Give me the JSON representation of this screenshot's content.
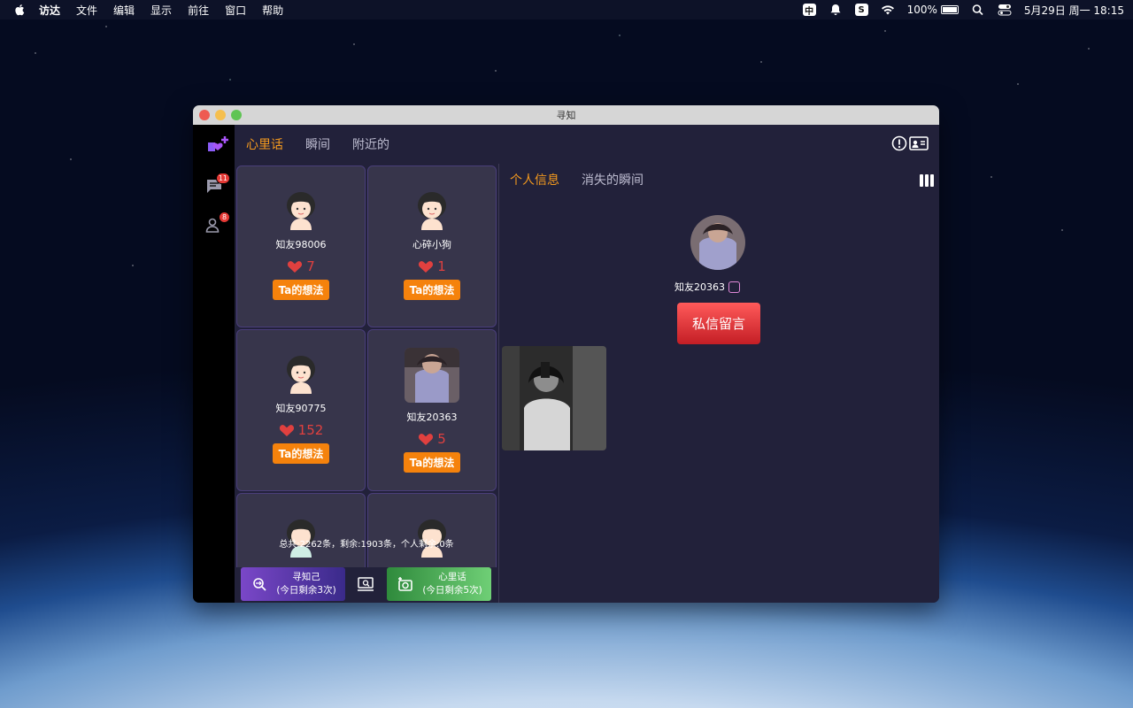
{
  "menubar": {
    "items": [
      "访达",
      "文件",
      "编辑",
      "显示",
      "前往",
      "窗口",
      "帮助"
    ],
    "input_method": "中",
    "sogou": "S",
    "battery": "100%",
    "datetime": "5月29日 周一  18:15"
  },
  "window": {
    "title": "寻知"
  },
  "rail": {
    "messages_badge": "11",
    "contacts_badge": "8"
  },
  "tabs": [
    "心里话",
    "瞬间",
    "附近的"
  ],
  "cards": [
    {
      "name": "知友98006",
      "hearts": "7",
      "button": "Ta的想法",
      "avatar": "face"
    },
    {
      "name": "心碎小狗",
      "hearts": "1",
      "button": "Ta的想法",
      "avatar": "face"
    },
    {
      "name": "知友90775",
      "hearts": "152",
      "button": "Ta的想法",
      "avatar": "face"
    },
    {
      "name": "知友20363",
      "hearts": "5",
      "button": "Ta的想法",
      "avatar": "photo"
    }
  ],
  "footer": {
    "summary": "总共:2262条，剩余:1903条，个人剩余:0条",
    "left_line1": "寻知己",
    "left_line2": "(今日剩余3次)",
    "right_line1": "心里话",
    "right_line2": "(今日剩余5次)"
  },
  "detail": {
    "tabs": [
      "个人信息",
      "消失的瞬间"
    ],
    "name": "知友20363",
    "dm_button": "私信留言"
  },
  "colors": {
    "accent": "#f59a1e",
    "heart": "#e0403f",
    "idea_button": "#f5820c",
    "dm_button": "#e53935"
  }
}
